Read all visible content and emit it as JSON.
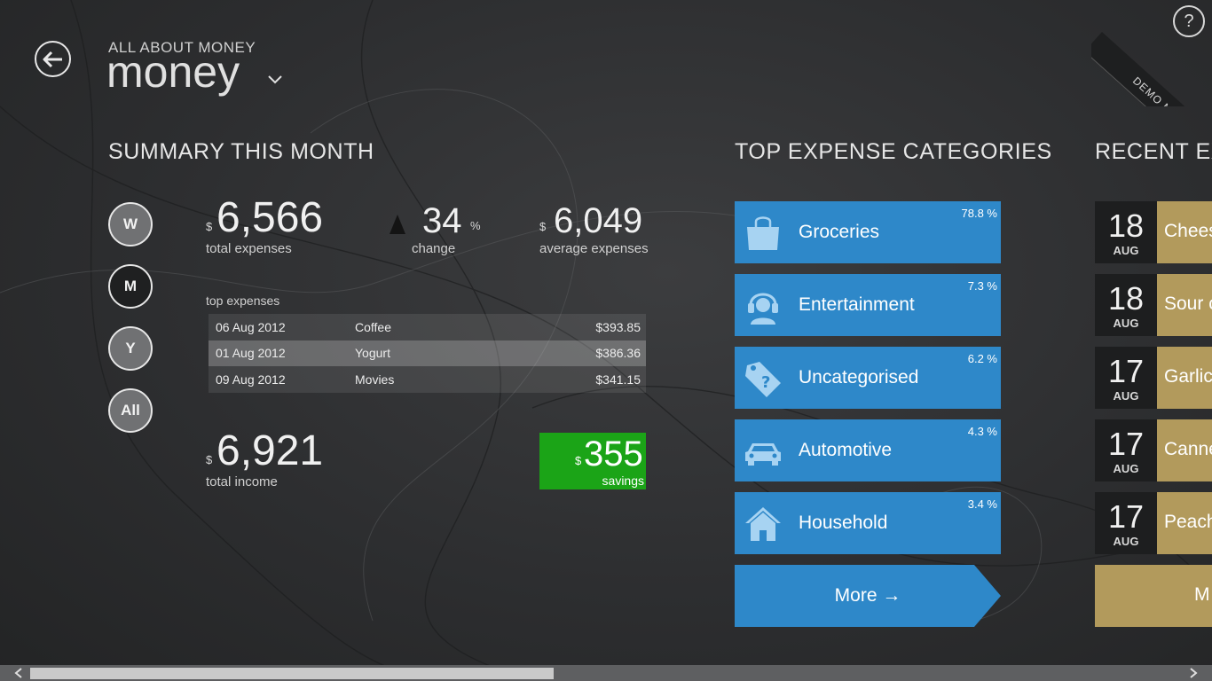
{
  "header": {
    "subtitle": "ALL ABOUT MONEY",
    "title": "money",
    "demo_ribbon": "DEMO MODE",
    "help": "?"
  },
  "summary": {
    "heading": "SUMMARY THIS MONTH",
    "periods": [
      "W",
      "M",
      "Y",
      "All"
    ],
    "active_period": "M",
    "currency": "$",
    "total_expenses": "6,566",
    "total_expenses_label": "total expenses",
    "change_value": "34",
    "change_unit": "%",
    "change_label": "change",
    "average_expenses": "6,049",
    "average_expenses_label": "average expenses",
    "top_expenses_label": "top expenses",
    "top_expenses": [
      {
        "date": "06 Aug 2012",
        "name": "Coffee",
        "amount": "$393.85"
      },
      {
        "date": "01 Aug 2012",
        "name": "Yogurt",
        "amount": "$386.36"
      },
      {
        "date": "09 Aug 2012",
        "name": "Movies",
        "amount": "$341.15"
      }
    ],
    "total_income": "6,921",
    "total_income_label": "total income",
    "savings": "355",
    "savings_label": "savings"
  },
  "categories": {
    "heading": "TOP EXPENSE CATEGORIES",
    "items": [
      {
        "name": "Groceries",
        "percent": "78.8 %",
        "icon": "shopping-bag-icon"
      },
      {
        "name": "Entertainment",
        "percent": "7.3 %",
        "icon": "headset-person-icon"
      },
      {
        "name": "Uncategorised",
        "percent": "6.2 %",
        "icon": "tag-question-icon"
      },
      {
        "name": "Automotive",
        "percent": "4.3 %",
        "icon": "car-icon"
      },
      {
        "name": "Household",
        "percent": "3.4 %",
        "icon": "house-icon"
      }
    ],
    "more_label": "More →"
  },
  "recent": {
    "heading": "RECENT EXP",
    "items": [
      {
        "day": "18",
        "month": "AUG",
        "name": "Chees"
      },
      {
        "day": "18",
        "month": "AUG",
        "name": "Sour c"
      },
      {
        "day": "17",
        "month": "AUG",
        "name": "Garlic"
      },
      {
        "day": "17",
        "month": "AUG",
        "name": "Canne"
      },
      {
        "day": "17",
        "month": "AUG",
        "name": "Peach"
      }
    ],
    "more_label": "M"
  },
  "colors": {
    "tile_blue": "#2e88c9",
    "savings_green": "#1ba417",
    "recent_gold": "#b29a5c"
  }
}
